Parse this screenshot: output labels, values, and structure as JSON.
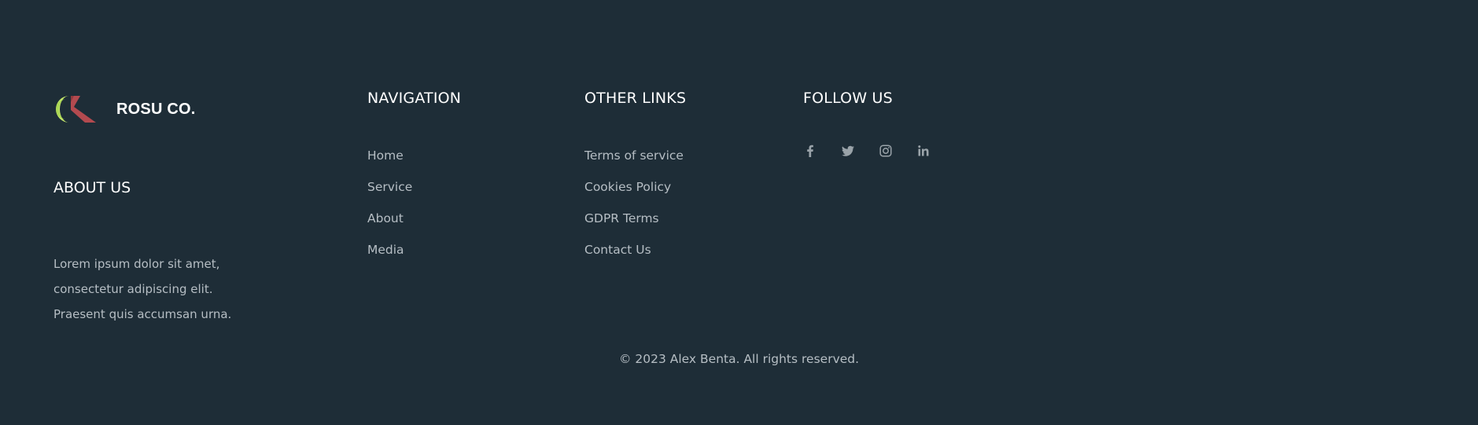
{
  "brand": {
    "name": "ROSU CO.",
    "logo_icon": "rosu-k-logo",
    "logo_colors": [
      "#c6e96b",
      "#b34a4f"
    ]
  },
  "about": {
    "title": "ABOUT US",
    "lines": [
      "Lorem ipsum dolor sit amet,",
      "consectetur adipiscing elit.",
      "Praesent quis accumsan urna."
    ]
  },
  "navigation": {
    "title": "NAVIGATION",
    "links": [
      "Home",
      "Service",
      "About",
      "Media"
    ]
  },
  "other_links": {
    "title": "OTHER LINKS",
    "links": [
      "Terms of service",
      "Cookies Policy",
      "GDPR Terms",
      "Contact Us"
    ]
  },
  "follow": {
    "title": "FOLLOW US",
    "icons": [
      "facebook-icon",
      "twitter-icon",
      "instagram-icon",
      "linkedin-icon"
    ]
  },
  "copyright": "© 2023 Alex Benta. All rights reserved.",
  "colors": {
    "background": "#1e2d37",
    "heading": "#ffffff",
    "muted_text": "#b6bec4",
    "icon": "#9aa3a9"
  }
}
